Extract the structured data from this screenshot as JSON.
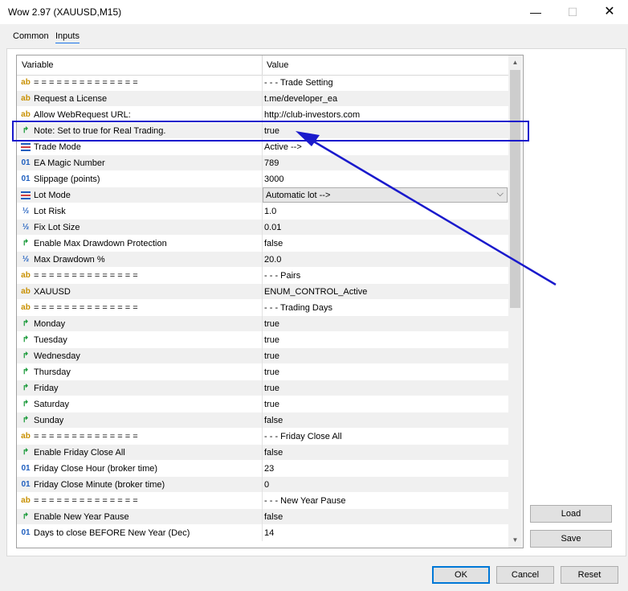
{
  "window": {
    "title": "Wow 2.97 (XAUUSD,M15)",
    "min": "—",
    "max": "☐",
    "close": "✕"
  },
  "tabs": [
    "Common",
    "Inputs"
  ],
  "columns": {
    "variable": "Variable",
    "value": "Value"
  },
  "rows": [
    {
      "icon": "ab",
      "name": "= = = = = = = = = = = = = =",
      "value": "- - - Trade Setting"
    },
    {
      "icon": "ab",
      "name": "Request a License",
      "value": "t.me/developer_ea"
    },
    {
      "icon": "ab",
      "name": "Allow WebRequest URL:",
      "value": "http://club-investors.com"
    },
    {
      "icon": "flag",
      "name": "Note: Set to true for Real Trading.",
      "value": "true"
    },
    {
      "icon": "enum",
      "name": "Trade Mode",
      "value": "Active -->"
    },
    {
      "icon": "01",
      "name": "EA Magic Number",
      "value": "789"
    },
    {
      "icon": "01",
      "name": "Slippage (points)",
      "value": "3000"
    },
    {
      "icon": "enum",
      "name": "Lot Mode",
      "value": "Automatic lot -->"
    },
    {
      "icon": "half",
      "name": "Lot Risk",
      "value": "1.0"
    },
    {
      "icon": "half",
      "name": "Fix Lot Size",
      "value": "0.01"
    },
    {
      "icon": "flag",
      "name": "Enable Max Drawdown Protection",
      "value": "false"
    },
    {
      "icon": "half",
      "name": "Max Drawdown %",
      "value": "20.0"
    },
    {
      "icon": "ab",
      "name": "= = = = = = = = = = = = = =",
      "value": "- - - Pairs"
    },
    {
      "icon": "ab",
      "name": "XAUUSD",
      "value": "ENUM_CONTROL_Active"
    },
    {
      "icon": "ab",
      "name": "= = = = = = = = = = = = = =",
      "value": "- - - Trading Days"
    },
    {
      "icon": "flag",
      "name": "Monday",
      "value": "true"
    },
    {
      "icon": "flag",
      "name": "Tuesday",
      "value": "true"
    },
    {
      "icon": "flag",
      "name": "Wednesday",
      "value": "true"
    },
    {
      "icon": "flag",
      "name": "Thursday",
      "value": "true"
    },
    {
      "icon": "flag",
      "name": "Friday",
      "value": "true"
    },
    {
      "icon": "flag",
      "name": "Saturday",
      "value": "true"
    },
    {
      "icon": "flag",
      "name": "Sunday",
      "value": "false"
    },
    {
      "icon": "ab",
      "name": "= = = = = = = = = = = = = =",
      "value": "- - - Friday Close All"
    },
    {
      "icon": "flag",
      "name": "Enable Friday Close All",
      "value": "false"
    },
    {
      "icon": "01",
      "name": "Friday Close Hour (broker time)",
      "value": "23"
    },
    {
      "icon": "01",
      "name": "Friday Close Minute (broker time)",
      "value": "0"
    },
    {
      "icon": "ab",
      "name": "= = = = = = = = = = = = = =",
      "value": "- - - New Year Pause"
    },
    {
      "icon": "flag",
      "name": "Enable New Year Pause",
      "value": "false"
    },
    {
      "icon": "01",
      "name": "Days to close BEFORE New Year (Dec)",
      "value": "14"
    }
  ],
  "icon_glyphs": {
    "ab": "ab",
    "01": "01",
    "half": "½",
    "flag": "↱"
  },
  "icon_names": {
    "ab": "string-icon",
    "01": "integer-icon",
    "half": "double-icon",
    "flag": "bool-icon",
    "enum": "enum-icon"
  },
  "combo_arrow": "⌵",
  "scroll": {
    "up": "▲",
    "down": "▼"
  },
  "buttons": {
    "load": "Load",
    "save": "Save",
    "ok": "OK",
    "cancel": "Cancel",
    "reset": "Reset"
  },
  "colors": {
    "highlight": "#1a1acc",
    "accent": "#0078d7"
  }
}
